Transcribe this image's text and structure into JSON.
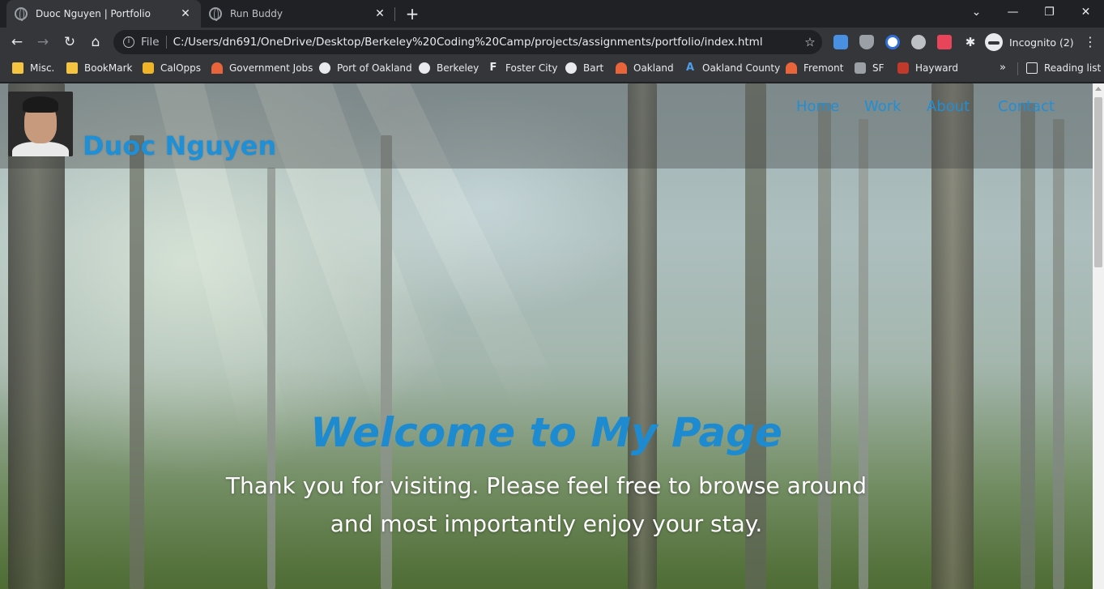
{
  "tabs": [
    {
      "title": "Duoc Nguyen | Portfolio",
      "active": true
    },
    {
      "title": "Run Buddy",
      "active": false
    }
  ],
  "window_controls": {
    "minimize": "—",
    "restore": "❐",
    "close": "✕",
    "tab_search": "⌄",
    "new_tab": "+"
  },
  "toolbar": {
    "back": "←",
    "forward": "→",
    "reload": "↻",
    "home": "⌂",
    "file_label": "File",
    "url": "C:/Users/dn691/OneDrive/Desktop/Berkeley%20Coding%20Camp/projects/assignments/portfolio/index.html",
    "bookmark_star": "☆",
    "incognito_label": "Incognito (2)",
    "menu": "⋮"
  },
  "bookmarks": [
    {
      "label": "Misc.",
      "icon": "folder-icon"
    },
    {
      "label": "BookMark",
      "icon": "folder-icon"
    },
    {
      "label": "CalOpps",
      "icon": "calopps-icon"
    },
    {
      "label": "Government Jobs",
      "icon": "arch-icon"
    },
    {
      "label": "Port of Oakland",
      "icon": "globe-icon"
    },
    {
      "label": "Berkeley",
      "icon": "globe-icon"
    },
    {
      "label": "Foster City",
      "icon": "foster-city-icon"
    },
    {
      "label": "Bart",
      "icon": "globe-icon"
    },
    {
      "label": "Oakland",
      "icon": "arch-icon"
    },
    {
      "label": "Oakland County",
      "icon": "oakland-county-icon"
    },
    {
      "label": "Fremont",
      "icon": "arch-icon"
    },
    {
      "label": "SF",
      "icon": "sf-seal-icon"
    },
    {
      "label": "Hayward",
      "icon": "hayward-icon"
    }
  ],
  "bookmarks_more": "»",
  "reading_list": "Reading list",
  "site": {
    "name": "Duoc Nguyen",
    "nav": [
      "Home",
      "Work",
      "About",
      "Contact"
    ],
    "hero_title": "Welcome to My Page",
    "hero_line1": "Thank you for visiting. Please feel free to browse around",
    "hero_line2": "and most importantly enjoy your stay."
  },
  "colors": {
    "chrome_dark": "#202124",
    "chrome_toolbar": "#35363a",
    "site_accent": "#1f8fd6",
    "hero_text": "#ffffff"
  }
}
